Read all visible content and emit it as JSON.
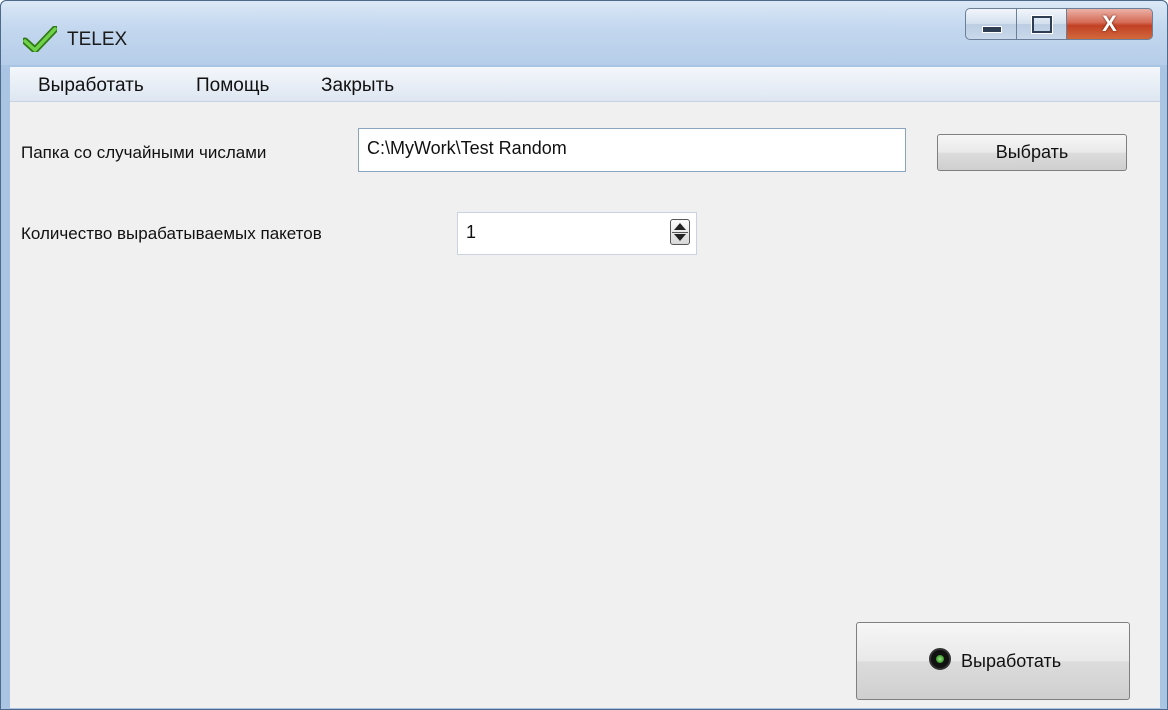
{
  "window": {
    "title": "TELEX",
    "buttons": {
      "minimize": "minimize",
      "maximize": "maximize",
      "close": "X"
    }
  },
  "menu": {
    "items": [
      "Выработать",
      "Помощь",
      "Закрыть"
    ]
  },
  "form": {
    "folder_label": "Папка со случайными числами",
    "folder_value": "C:\\MyWork\\Test Random",
    "browse_label": "Выбрать",
    "packets_label": "Количество вырабатываемых пакетов",
    "packets_value": "1"
  },
  "actions": {
    "generate_label": "Выработать"
  },
  "icons": {
    "app": "checkmark-icon",
    "generate": "status-led-icon",
    "spinner": "spin-up-down-icon"
  },
  "colors": {
    "titlebar": "#c4d8ef",
    "client_background": "#f0f0f0",
    "close_button": "#c34024",
    "app_icon_check": "#3aa51f"
  }
}
